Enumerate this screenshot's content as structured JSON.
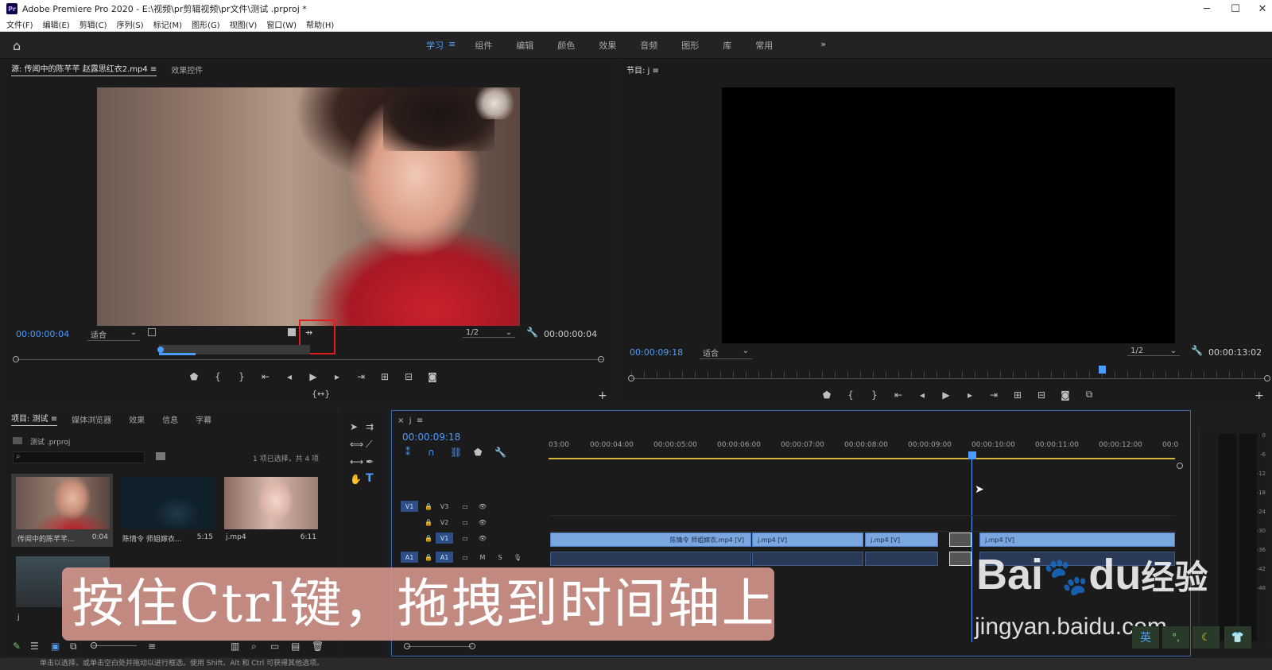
{
  "titlebar": {
    "app_title": "Adobe Premiere Pro 2020 - E:\\视频\\pr剪辑视频\\pr文件\\测试 .prproj *",
    "logo": "Pr"
  },
  "menu": [
    "文件(F)",
    "编辑(E)",
    "剪辑(C)",
    "序列(S)",
    "标记(M)",
    "图形(G)",
    "视图(V)",
    "窗口(W)",
    "帮助(H)"
  ],
  "workspaces": {
    "items": [
      "学习",
      "组件",
      "编辑",
      "颜色",
      "效果",
      "音频",
      "图形",
      "库",
      "常用"
    ],
    "active": "学习",
    "more": "»",
    "menu_icon": "≡"
  },
  "source": {
    "tab_label": "源: 传闻中的陈芊芊 赵露思红衣2.mp4",
    "tab_menu": "≡",
    "effects_tab": "效果控件",
    "timecode": "00:00:00:04",
    "fit": "适合",
    "resolution": "1/2",
    "duration": "00:00:00:04",
    "playhead_fraction": 0.0
  },
  "program": {
    "tab_label": "节目: j",
    "tab_menu": "≡",
    "timecode": "00:00:09:18",
    "fit": "适合",
    "resolution": "1/2",
    "duration": "00:00:13:02"
  },
  "project": {
    "tabs": [
      "项目: 测试",
      "媒体浏览器",
      "效果",
      "信息",
      "字幕"
    ],
    "tab_menu": "≡",
    "file": "测试 .prproj",
    "selection_info": "1 项已选择，共 4 项",
    "items": [
      {
        "name": "传闻中的陈芊芊...",
        "dur": "0:04"
      },
      {
        "name": "陈情令 师姐嫁衣...",
        "dur": "5:15"
      },
      {
        "name": "j.mp4",
        "dur": "6:11"
      },
      {
        "name": "j",
        "dur": ""
      }
    ]
  },
  "timeline": {
    "close": "×",
    "name": "j",
    "menu": "≡",
    "timecode": "00:00:09:18",
    "ruler": [
      "03:00",
      "00:00:04:00",
      "00:00:05:00",
      "00:00:06:00",
      "00:00:07:00",
      "00:00:08:00",
      "00:00:09:00",
      "00:00:10:00",
      "00:00:11:00",
      "00:00:12:00",
      "00:0"
    ],
    "tracks": {
      "v3": "V3",
      "v2": "V2",
      "v1": "V1",
      "a1": "A1",
      "m": "M",
      "s": "S"
    },
    "clips": [
      "陈情令 师姐嫁衣.mp4 [V]",
      "j.mp4 [V]",
      "j.mp4 [V]",
      "j.mp4 [V]"
    ]
  },
  "subtitle": "按住Ctrl键，拖拽到时间轴上",
  "watermark": {
    "brand": "Bai",
    "brand2": "du",
    "suffix": "经验",
    "url": "jingyan.baidu.com"
  },
  "meter_labels": [
    "0",
    "-6",
    "-12",
    "-18",
    "-24",
    "-30",
    "-36",
    "-42",
    "-48"
  ],
  "status": "单击以选择，或单击空白处并拖动以进行框选。使用 Shift、Alt 和 Ctrl 可获得其他选项。",
  "colors": {
    "accent": "#4b9cff",
    "clip": "#7ba7e0",
    "highlight_box": "#e02020",
    "subtitle_bg": "#d4968c"
  }
}
